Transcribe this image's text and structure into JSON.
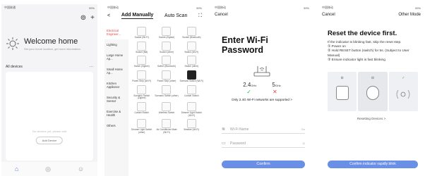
{
  "screen1": {
    "status_left": "中国联通",
    "status_right": "99%",
    "welcome_title": "Welcome home",
    "welcome_subtitle": "Set your home location, get more information",
    "devices_label": "All devices",
    "more": "···",
    "no_devices": "No devices yet, please add",
    "add_device": "Add Device"
  },
  "screen2": {
    "status_left": "中国移动",
    "status_right": "99%",
    "back": "<",
    "tab_manual": "Add Manually",
    "tab_auto": "Auto Scan",
    "categories": [
      "Electrical Engineer...",
      "Lighting",
      "Large Home Ap...",
      "Small Home Ap...",
      "Kitchen Appliance",
      "Security & Sensor",
      "Exercise & Health",
      "Others"
    ],
    "devices": [
      "Socket (Wi-Fi)",
      "Socket (Zigbee)",
      "Socket (Bluetooth)",
      "Socket (NB)",
      "Socket (other)",
      "Switch (Wi-Fi)",
      "Switch (Zigbee)",
      "Switch (Bluetooth)",
      "Switch (other)",
      "Power Strip (Wi-Fi)",
      "Power Strip (other)",
      "Scenario Switch (Wi-Fi)",
      "Scenario Switch (Zigbee)",
      "Scenario Switch (other)",
      "Curtain Switch",
      "Curtain Switch",
      "Wireless Switch",
      "Dimmer Light Switch (Wi-Fi)",
      "Dimmer Light Switch (other)",
      "Air Conditioner Mate (Wi-Fi)",
      "Breaker (Wi-Fi)"
    ]
  },
  "screen3": {
    "status_left": "中国移动",
    "status_right": "99%",
    "cancel": "Cancel",
    "title": "Enter Wi-Fi Password",
    "freq_24": "2.4",
    "freq_5": "5",
    "ghz": "GHz",
    "note": "Only 2.4G Wi-Fi networks are supported >",
    "wifi_placeholder": "Wi-Fi Name",
    "wifi_right": "Go",
    "password_placeholder": "Password",
    "confirm": "Confirm"
  },
  "screen4": {
    "status_left": "中国移动",
    "status_right": "99%",
    "cancel": "Cancel",
    "other_mode": "Other Mode",
    "title": "Reset the device first.",
    "instructions": "If the indicator is blinking fast, skip the reset step.\n① Power on\n② Hold RESET button (switch) for 5s. (Subject to User Manual)\n③ Ensure indicator light is fast blinking",
    "reset_link": "Resetting Devices >",
    "confirm": "Confirm indicator rapidly blink"
  },
  "colors": {
    "accent": "#6a8fe6",
    "check": "#3cb54a",
    "cross": "#e24848",
    "active_category": "#e24848"
  }
}
